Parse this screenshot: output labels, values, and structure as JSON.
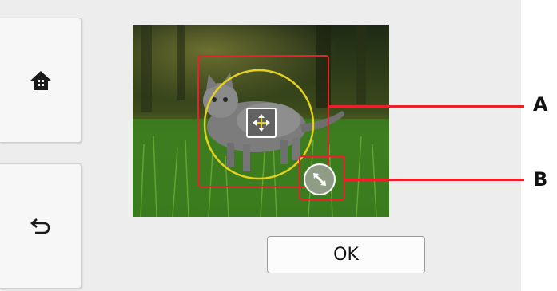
{
  "buttons": {
    "home_icon": "home-icon",
    "back_icon": "back-arrow-icon",
    "ok_label": "OK"
  },
  "handles": {
    "move_icon": "move-icon",
    "resize_icon": "resize-icon"
  },
  "callouts": {
    "a_label": "A",
    "b_label": "B"
  },
  "colors": {
    "callout": "#e8212a",
    "trim_circle": "#e3d21b",
    "screen_bg": "#ededed"
  }
}
